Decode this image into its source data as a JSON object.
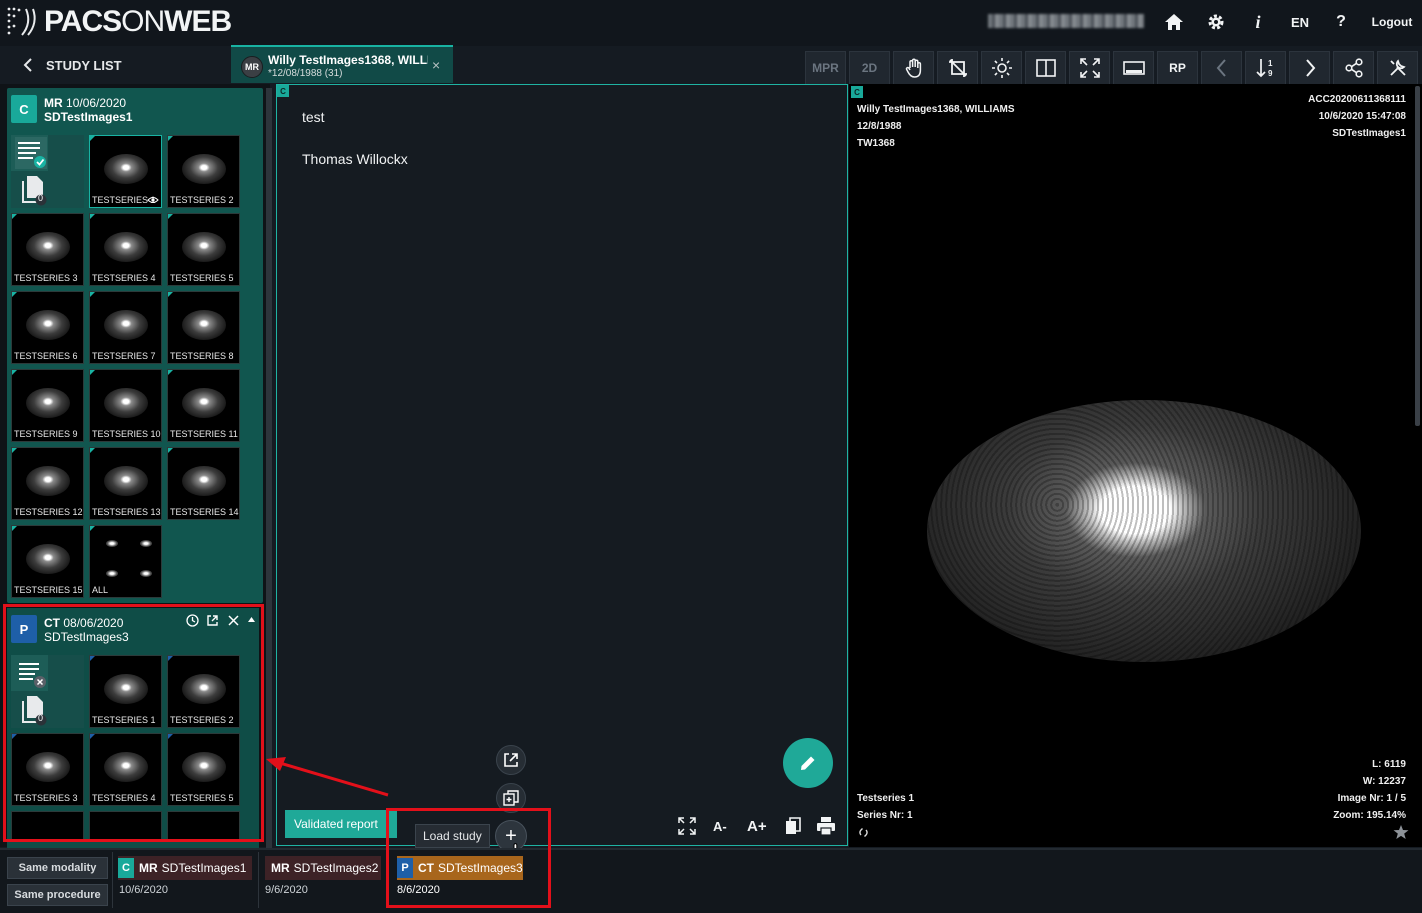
{
  "app": {
    "logo_a": "PACS",
    "logo_b": "ON",
    "logo_c": "WEB"
  },
  "topnav": {
    "language": "EN",
    "help": "?",
    "info": "i",
    "logout": "Logout"
  },
  "study_list_label": "STUDY LIST",
  "patient_tab": {
    "badge": "MR",
    "name": "Willy TestImages1368, WILLIAMS",
    "dob": "*12/08/1988 (31)",
    "close": "×"
  },
  "toolbar": {
    "mpr": "MPR",
    "twod": "2D",
    "rp": "RP"
  },
  "study1": {
    "badge": "C",
    "modality": "MR",
    "date": "10/06/2020",
    "name": "SDTestImages1",
    "doc_count": "0",
    "series": [
      "TESTSERIES 1",
      "TESTSERIES 2",
      "TESTSERIES 3",
      "TESTSERIES 4",
      "TESTSERIES 5",
      "TESTSERIES 6",
      "TESTSERIES 7",
      "TESTSERIES 8",
      "TESTSERIES 9",
      "TESTSERIES 10",
      "TESTSERIES 11",
      "TESTSERIES 12",
      "TESTSERIES 13",
      "TESTSERIES 14",
      "TESTSERIES 15",
      "ALL"
    ]
  },
  "study2": {
    "badge": "P",
    "modality": "CT",
    "date": "08/06/2020",
    "name": "SDTestImages3",
    "doc_count": "0",
    "series": [
      "TESTSERIES 1",
      "TESTSERIES 2",
      "TESTSERIES 3",
      "TESTSERIES 4",
      "TESTSERIES 5"
    ]
  },
  "report": {
    "marker": "C",
    "lines": [
      "test",
      "Thomas Willockx"
    ],
    "validated_label": "Validated report",
    "load_study_tooltip": "Load study",
    "plus": "+",
    "font_smaller": "A-",
    "font_larger": "A+"
  },
  "viewer": {
    "marker": "C",
    "patient": "Willy TestImages1368, WILLIAMS",
    "dob": "12/8/1988",
    "id": "TW1368",
    "accession": "ACC20200611368111",
    "datetime": "10/6/2020 15:47:08",
    "study": "SDTestImages1",
    "level": "L: 6119",
    "width": "W: 12237",
    "image_nr": "Image Nr: 1 / 5",
    "zoom": "Zoom: 195.14%",
    "series_name": "Testseries 1",
    "series_nr": "Series Nr: 1"
  },
  "bottom": {
    "same_modality": "Same modality",
    "same_procedure": "Same procedure",
    "studies": [
      {
        "badge": "C",
        "modality": "MR",
        "name": "SDTestImages1",
        "date": "10/6/2020"
      },
      {
        "badge": "",
        "modality": "MR",
        "name": "SDTestImages2",
        "date": "9/6/2020"
      },
      {
        "badge": "P",
        "modality": "CT",
        "name": "SDTestImages3",
        "date": "8/6/2020"
      }
    ]
  },
  "colors": {
    "accent": "#19b3a3",
    "highlight": "#e3101a",
    "ct_brown": "#a8661c",
    "mr_maroon": "#3d2226"
  }
}
